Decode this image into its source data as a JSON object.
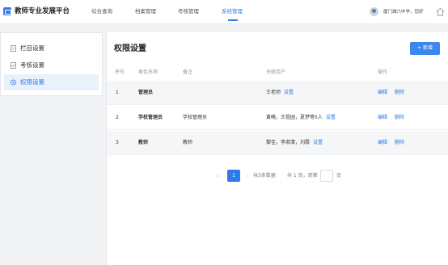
{
  "app": {
    "title": "教师专业发展平台"
  },
  "nav": {
    "items": [
      "综合查询",
      "档案管理",
      "考核管理",
      "系统管理"
    ],
    "active": "系统管理"
  },
  "user": {
    "name": "厦门城六中学，您好"
  },
  "sidebar": {
    "items": [
      {
        "label": "栏目设置"
      },
      {
        "label": "考核设置"
      },
      {
        "label": "权限设置"
      }
    ],
    "active": "权限设置"
  },
  "main": {
    "title": "权限设置",
    "add_label": "+ 新增",
    "columns": [
      "序号",
      "角色名称",
      "备注",
      "关联用户",
      "操作"
    ],
    "rows": [
      {
        "index": "1",
        "role": "管理员",
        "remark": "",
        "users": "王老师",
        "set": "设置",
        "edit": "编辑",
        "delete": "删除"
      },
      {
        "index": "2",
        "role": "学校管理员",
        "remark": "学校管理员",
        "users": "黄曦，王祖园，夏梦等5人",
        "set": "设置",
        "edit": "编辑",
        "delete": "删除"
      },
      {
        "index": "3",
        "role": "教师",
        "remark": "教师",
        "users": "黎佳，李淑清，刘霞",
        "set": "设置",
        "edit": "编辑",
        "delete": "删除"
      }
    ]
  },
  "pagination": {
    "prev": "‹",
    "current": "1",
    "next": "›",
    "total": "共3条数据",
    "pages": "共 1 页，到第",
    "unit": "页"
  },
  "colors": {
    "accent": "#2f7bea",
    "button": "#3d86ec"
  }
}
